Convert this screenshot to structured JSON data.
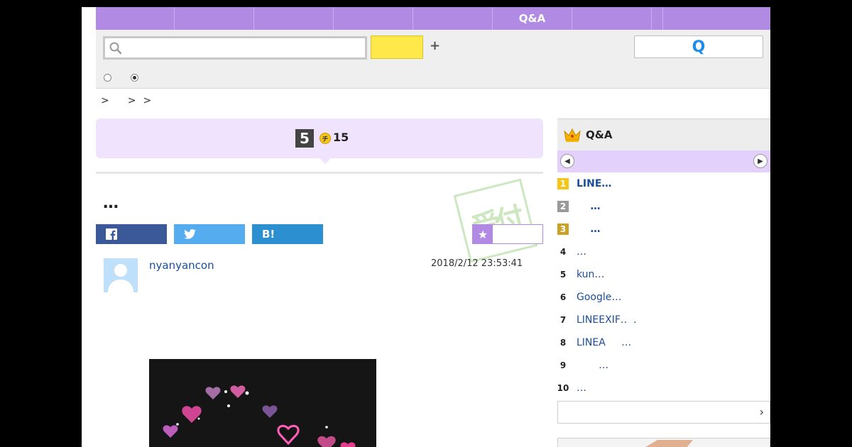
{
  "nav": {
    "items": [
      "",
      "",
      "",
      "",
      "",
      "Q&A",
      "",
      "",
      ""
    ]
  },
  "search": {
    "query": "",
    "placeholder": "",
    "button_label": "",
    "plus_label": "+",
    "qa_button_label": "Q"
  },
  "breadcrumb": [
    ">",
    ">",
    ">"
  ],
  "question": {
    "answer_count": "5",
    "coin_label": "チ",
    "coin_value": "15",
    "title": "…",
    "stamp_text": "受付"
  },
  "share": {
    "facebook_label": "f",
    "twitter_label": "",
    "hatena_label": "B!"
  },
  "post": {
    "username": "nyanyancon",
    "date": "2018/2/12  23:53:41"
  },
  "ranking": {
    "title": "Q&A",
    "items": [
      {
        "rank": "1",
        "title": "LINE…"
      },
      {
        "rank": "2",
        "title": "    …"
      },
      {
        "rank": "3",
        "title": "    …"
      },
      {
        "rank": "4",
        "title": "…"
      },
      {
        "rank": "5",
        "title": "kun…"
      },
      {
        "rank": "6",
        "title": "Google…"
      },
      {
        "rank": "7",
        "title": "LINEEXIF‥  ."
      },
      {
        "rank": "8",
        "title": "LINEA     …"
      },
      {
        "rank": "9",
        "title": "       …"
      },
      {
        "rank": "10",
        "title": "…"
      }
    ],
    "more_label": "›"
  },
  "colors": {
    "nav": "#b18ae4",
    "rank1": "#f5c518",
    "rank2": "#9a9a9a",
    "rank3": "#c9a227"
  }
}
